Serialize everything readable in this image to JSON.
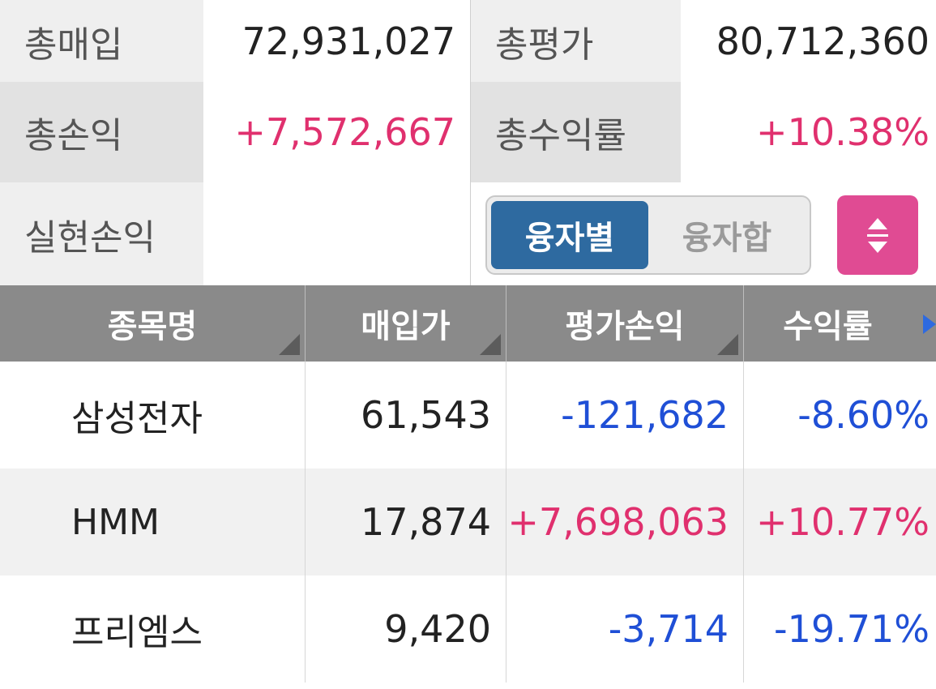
{
  "summary": {
    "total_purchase_label": "총매입",
    "total_purchase_value": "72,931,027",
    "total_eval_label": "총평가",
    "total_eval_value": "80,712,360",
    "total_pl_label": "총손익",
    "total_pl_value": "+7,572,667",
    "total_return_label": "총수익률",
    "total_return_value": "+10.38%",
    "realized_pl_label": "실현손익",
    "realized_pl_value": ""
  },
  "toggle": {
    "option_by_loan": "융자별",
    "option_loan_sum": "융자합",
    "selected": "융자별"
  },
  "sort_button": {
    "icon": "sort-updown-icon",
    "color": "#e04b93"
  },
  "table": {
    "columns": [
      "종목명",
      "매입가",
      "평가손익",
      "수익률"
    ],
    "rows": [
      {
        "name": "삼성전자",
        "price": "61,543",
        "pl": "-121,682",
        "rate": "-8.60%"
      },
      {
        "name": "HMM",
        "price": "17,874",
        "pl": "+7,698,063",
        "rate": "+10.77%"
      },
      {
        "name": "프리엠스",
        "price": "9,420",
        "pl": "-3,714",
        "rate": "-19.71%"
      }
    ]
  },
  "colors": {
    "positive": "#e0306e",
    "negative": "#1f4fd6",
    "toggle_active": "#2e6aa0",
    "header_bg": "#8a8a8a"
  }
}
